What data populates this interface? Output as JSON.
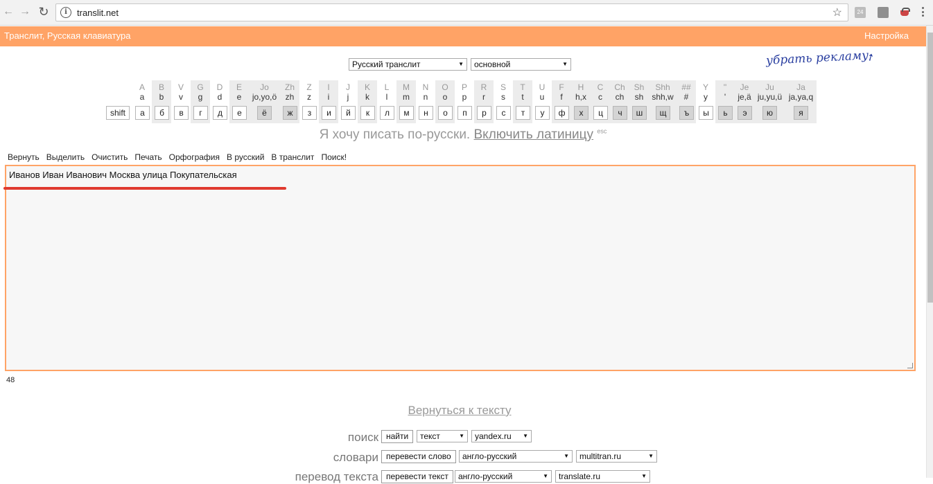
{
  "browser": {
    "url": "translit.net",
    "ext_badge": "24"
  },
  "header": {
    "title": "Транслит, Русская клавиатура",
    "settings": "Настройка"
  },
  "selects": {
    "mode": "Русский транслит",
    "layout": "основной"
  },
  "ad_link": "убрать рекламу",
  "keyboard": {
    "shift": "shift",
    "keys": [
      {
        "lat": "A",
        "low": "a",
        "cyr": "а",
        "dark": false
      },
      {
        "lat": "B",
        "low": "b",
        "cyr": "б",
        "dark": false
      },
      {
        "lat": "V",
        "low": "v",
        "cyr": "в",
        "dark": false
      },
      {
        "lat": "G",
        "low": "g",
        "cyr": "г",
        "dark": false
      },
      {
        "lat": "D",
        "low": "d",
        "cyr": "д",
        "dark": false
      },
      {
        "lat": "E",
        "low": "e",
        "cyr": "е",
        "dark": false
      },
      {
        "lat": "Jo",
        "low": "jo,yo,ö",
        "cyr": "ё",
        "dark": true
      },
      {
        "lat": "Zh",
        "low": "zh",
        "cyr": "ж",
        "dark": true
      },
      {
        "lat": "Z",
        "low": "z",
        "cyr": "з",
        "dark": false
      },
      {
        "lat": "I",
        "low": "i",
        "cyr": "и",
        "dark": false
      },
      {
        "lat": "J",
        "low": "j",
        "cyr": "й",
        "dark": false
      },
      {
        "lat": "K",
        "low": "k",
        "cyr": "к",
        "dark": false
      },
      {
        "lat": "L",
        "low": "l",
        "cyr": "л",
        "dark": false
      },
      {
        "lat": "M",
        "low": "m",
        "cyr": "м",
        "dark": false
      },
      {
        "lat": "N",
        "low": "n",
        "cyr": "н",
        "dark": false
      },
      {
        "lat": "O",
        "low": "o",
        "cyr": "о",
        "dark": false
      },
      {
        "lat": "P",
        "low": "p",
        "cyr": "п",
        "dark": false
      },
      {
        "lat": "R",
        "low": "r",
        "cyr": "р",
        "dark": false
      },
      {
        "lat": "S",
        "low": "s",
        "cyr": "с",
        "dark": false
      },
      {
        "lat": "T",
        "low": "t",
        "cyr": "т",
        "dark": false
      },
      {
        "lat": "U",
        "low": "u",
        "cyr": "у",
        "dark": false
      },
      {
        "lat": "F",
        "low": "f",
        "cyr": "ф",
        "dark": false
      },
      {
        "lat": "H",
        "low": "h,x",
        "cyr": "х",
        "dark": true
      },
      {
        "lat": "C",
        "low": "c",
        "cyr": "ц",
        "dark": false
      },
      {
        "lat": "Ch",
        "low": "ch",
        "cyr": "ч",
        "dark": true
      },
      {
        "lat": "Sh",
        "low": "sh",
        "cyr": "ш",
        "dark": true
      },
      {
        "lat": "Shh",
        "low": "shh,w",
        "cyr": "щ",
        "dark": true
      },
      {
        "lat": "##",
        "low": "#",
        "cyr": "ъ",
        "dark": true
      },
      {
        "lat": "Y",
        "low": "y",
        "cyr": "ы",
        "dark": false
      },
      {
        "lat": "''",
        "low": "'",
        "cyr": "ь",
        "dark": true
      },
      {
        "lat": "Je",
        "low": "je,ä",
        "cyr": "э",
        "dark": true
      },
      {
        "lat": "Ju",
        "low": "ju,yu,ü",
        "cyr": "ю",
        "dark": true
      },
      {
        "lat": "Ja",
        "low": "ja,ya,q",
        "cyr": "я",
        "dark": true
      }
    ]
  },
  "mode_text": {
    "prefix": "Я хочу писать по-русски.",
    "toggle": "Включить латиницу",
    "hint": "esc"
  },
  "toolbar": [
    "Вернуть",
    "Выделить",
    "Очистить",
    "Печать",
    "Орфография",
    "В русский",
    "В транслит",
    "Поиск!"
  ],
  "editor": {
    "text": "Иванов Иван Иванович Москва улица Покупательская",
    "count": "48"
  },
  "back_link": "Вернуться к тексту",
  "search": {
    "label": "поиск",
    "button": "найти",
    "type": "текст",
    "engine": "yandex.ru"
  },
  "dict": {
    "label": "словари",
    "button": "перевести слово",
    "lang": "англо-русский",
    "service": "multitran.ru"
  },
  "translate": {
    "label": "перевод текста",
    "button": "перевести текст",
    "lang": "англо-русский",
    "service": "translate.ru"
  }
}
